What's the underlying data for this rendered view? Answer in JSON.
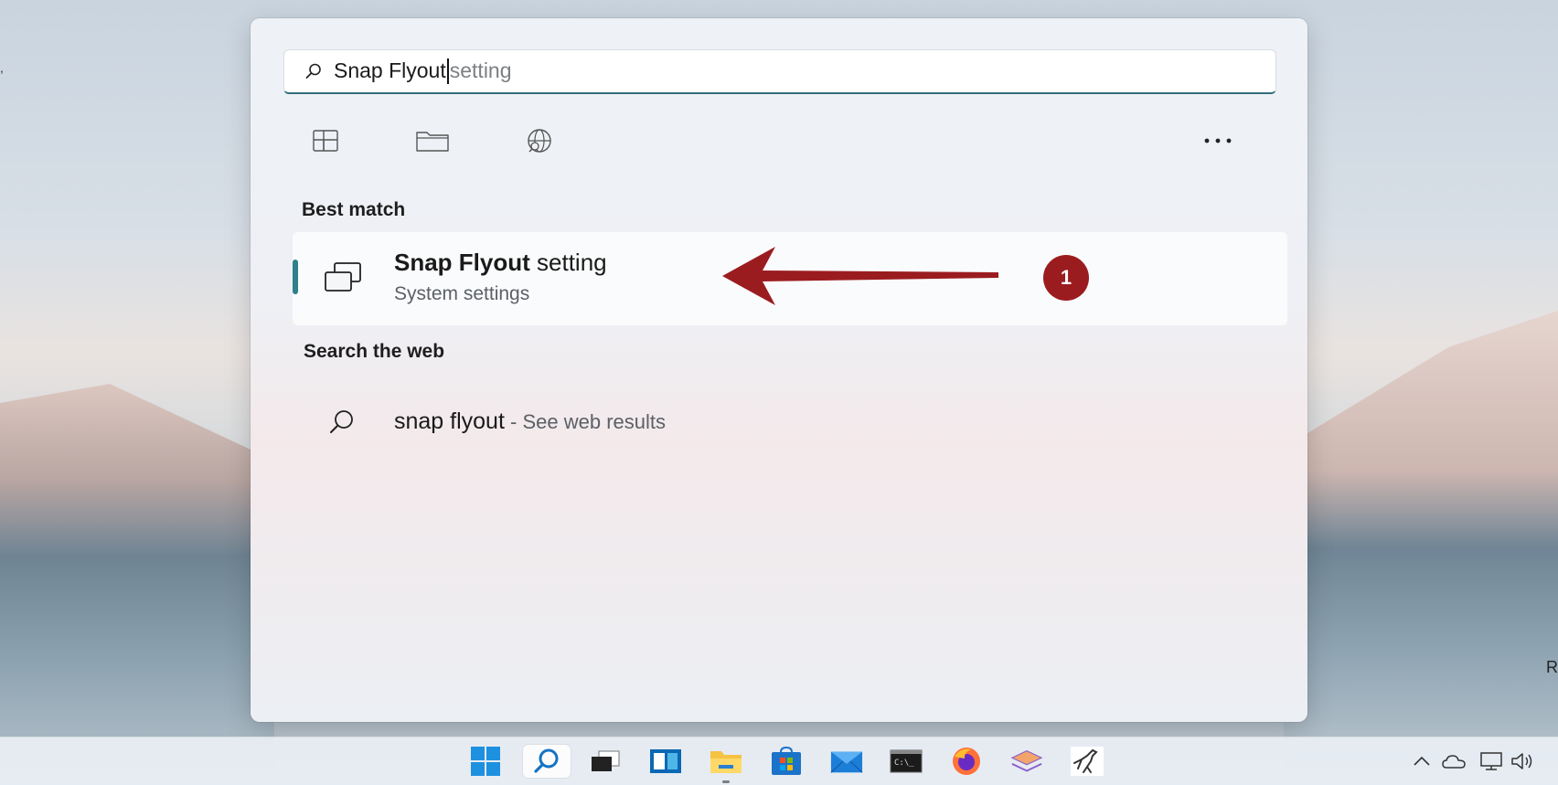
{
  "desktop": {
    "edge_text_right": "R",
    "edge_text_left": ","
  },
  "search": {
    "typed": "Snap Flyout",
    "autocomplete": "setting"
  },
  "filters": {
    "apps_icon": "apps-grid-icon",
    "documents_icon": "folder-icon",
    "web_icon": "globe-search-icon",
    "more_icon": "more-horizontal-icon"
  },
  "best_match": {
    "heading": "Best match",
    "title_bold": "Snap Flyout",
    "title_rest": " setting",
    "subtitle": "System settings",
    "icon": "snap-windows-icon"
  },
  "web": {
    "heading": "Search the web",
    "query": "snap flyout",
    "suffix": " - See web results",
    "icon": "search-icon"
  },
  "annotation": {
    "badge": "1",
    "color": "#9b1c1f"
  },
  "taskbar": {
    "apps": [
      "start",
      "search",
      "task-view",
      "widgets",
      "file-explorer",
      "microsoft-store",
      "mail",
      "terminal",
      "firefox",
      "layers-app",
      "dinosaur-app"
    ],
    "tray": [
      "chevron-up",
      "onedrive",
      "network",
      "volume"
    ]
  },
  "colors": {
    "accent": "#2f7f8c",
    "annotation": "#9b1c1f"
  }
}
